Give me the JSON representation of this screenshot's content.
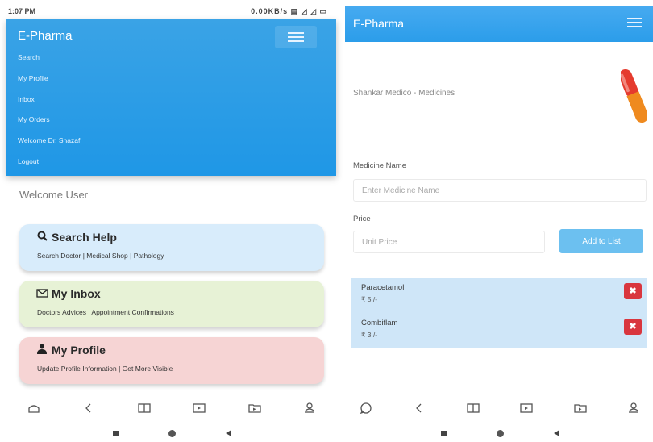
{
  "left": {
    "status": {
      "time": "1:07 PM",
      "indicators": "0.00KB/s ▤ ◿ ◿ ▭"
    },
    "brand": "E-Pharma",
    "menu": [
      "Search",
      "My Profile",
      "Inbox",
      "My Orders",
      "Welcome Dr. Shazaf",
      "Logout"
    ],
    "welcome": "Welcome User",
    "cards": [
      {
        "title": "Search Help",
        "icon": "search-icon",
        "subtitle": "Search Doctor | Medical Shop | Pathology",
        "color": "#d8ecfb"
      },
      {
        "title": "My Inbox",
        "icon": "envelope-icon",
        "subtitle": "Doctors Advices | Appointment Confirmations",
        "color": "#e7f2d6"
      },
      {
        "title": "My Profile",
        "icon": "user-icon",
        "subtitle": "Update Profile Information | Get More Visible",
        "color": "#f6d4d4"
      }
    ],
    "nav_icons": [
      "home-icon",
      "back-icon",
      "book-icon",
      "video-icon",
      "folder-icon",
      "user-icon"
    ]
  },
  "right": {
    "brand": "E-Pharma",
    "shop_title": "Shankar Medico - Medicines",
    "medicine_label": "Medicine Name",
    "medicine_placeholder": "Enter Medicine Name",
    "price_label": "Price",
    "price_placeholder": "Unit Price",
    "add_button": "Add to List",
    "items": [
      {
        "name": "Paracetamol",
        "price": "₹ 5 /-"
      },
      {
        "name": "Combiflam",
        "price": "₹ 3 /-"
      }
    ]
  },
  "colors": {
    "header": "#2b9dea",
    "remove": "#d9363e",
    "add_button": "#6cc0f0",
    "cart_bg": "#cfe6f8"
  }
}
